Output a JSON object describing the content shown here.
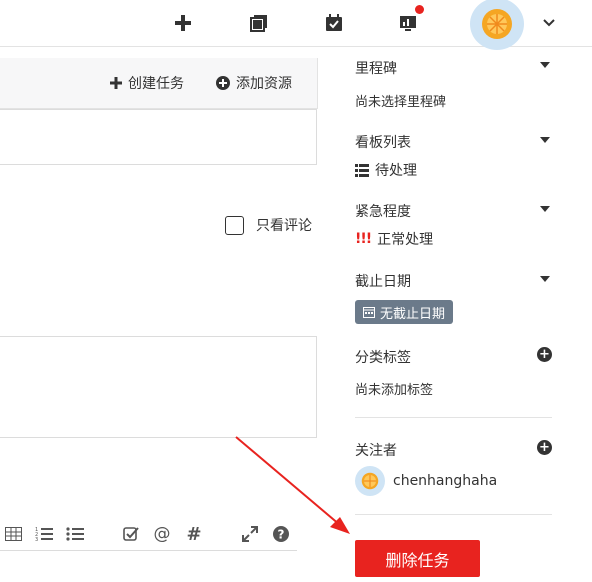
{
  "topbar": {
    "icons": [
      "plus-icon",
      "copy-icon",
      "calendar-check-icon",
      "chart-board-icon",
      "chevron-down-icon"
    ],
    "notification_color": "#e8231f"
  },
  "main": {
    "create_task_label": "创建任务",
    "add_resource_label": "添加资源",
    "only_comments_label": "只看评论"
  },
  "editor_toolbar": {
    "icons": [
      "table-icon",
      "ordered-list-icon",
      "bullet-list-icon",
      "checklist-icon",
      "at-icon",
      "hash-icon",
      "expand-icon",
      "help-icon"
    ]
  },
  "sidebar": {
    "milestone": {
      "title": "里程碑",
      "value": "尚未选择里程碑"
    },
    "board_list": {
      "title": "看板列表",
      "value": "待处理"
    },
    "urgency": {
      "title": "紧急程度",
      "marker": "!!!",
      "value": "正常处理"
    },
    "due_date": {
      "title": "截止日期",
      "value": "无截止日期"
    },
    "tags": {
      "title": "分类标签",
      "value": "尚未添加标签"
    },
    "followers": {
      "title": "关注者",
      "user": "chenhanghaha"
    },
    "delete_label": "删除任务"
  },
  "colors": {
    "accent_red": "#e8231f",
    "badge": "#6b7a8a",
    "avatar_bg": "#cfe4f5",
    "orange": "#f5a623"
  }
}
